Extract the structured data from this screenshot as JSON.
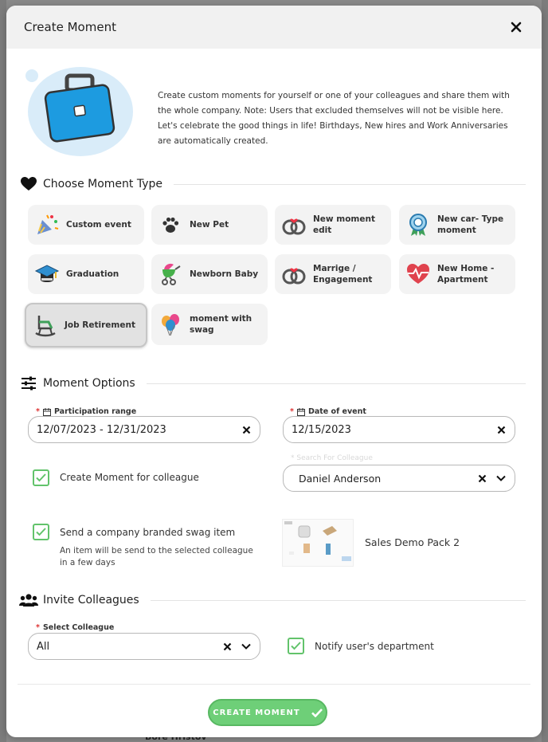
{
  "modal": {
    "title": "Create Moment",
    "intro": "Create custom moments for yourself or one of your colleagues and share them with the whole company. Note: Users that excluded themselves will not be visible here. Let's celebrate the good things in life! Birthdays, New hires and Work Anniversaries are automatically created."
  },
  "sections": {
    "type_title": "Choose Moment Type",
    "options_title": "Moment Options",
    "invite_title": "Invite Colleagues"
  },
  "moment_types": [
    {
      "label": "Custom event",
      "icon": "party-popper-icon"
    },
    {
      "label": "New Pet",
      "icon": "paw-icon"
    },
    {
      "label": "New moment edit",
      "icon": "rings-icon"
    },
    {
      "label": "New car- Type moment",
      "icon": "award-ribbon-icon"
    },
    {
      "label": "Graduation",
      "icon": "graduation-cap-icon"
    },
    {
      "label": "Newborn Baby",
      "icon": "baby-stroller-icon"
    },
    {
      "label": "Marrige / Engagement",
      "icon": "rings-icon"
    },
    {
      "label": "New Home - Apartment",
      "icon": "heartbeat-home-icon"
    },
    {
      "label": "Job Retirement",
      "icon": "rocking-chair-icon",
      "selected": true
    },
    {
      "label": "moment with swag",
      "icon": "balloons-icon"
    }
  ],
  "options": {
    "participation_label": "Participation range",
    "participation_value": "12/07/2023 - 12/31/2023",
    "date_label": "Date of event",
    "date_value": "12/15/2023",
    "colleague_check_label": "Create Moment for colleague",
    "colleague_placeholder": "Search For Colleague",
    "colleague_value": "Daniel Anderson",
    "swag_check_label": "Send a company branded swag item",
    "swag_sub": "An item will be send to the selected colleague in a few days",
    "swag_name": "Sales Demo Pack 2"
  },
  "invite": {
    "select_label": "Select Colleague",
    "select_value": "All",
    "notify_label": "Notify user's department"
  },
  "cta": {
    "label": "CREATE MOMENT"
  },
  "backdrop": {
    "name": "Bore Hristov"
  },
  "colors": {
    "accent": "#6ecf78",
    "check": "#62c36b",
    "required": "#d33333"
  }
}
